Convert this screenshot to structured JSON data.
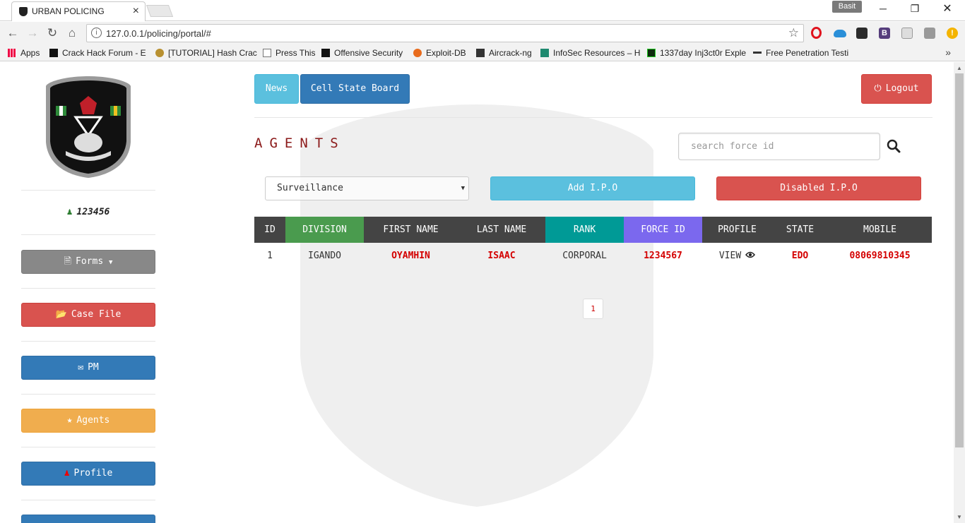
{
  "browser": {
    "tab_title": "URBAN POLICING",
    "profile_name": "Basit",
    "url": "127.0.0.1/policing/portal/#",
    "bookmarks": [
      {
        "label": "Apps"
      },
      {
        "label": "Crack Hack Forum - E"
      },
      {
        "label": "[TUTORIAL] Hash Crac"
      },
      {
        "label": "Press This"
      },
      {
        "label": "Offensive Security"
      },
      {
        "label": "Exploit-DB"
      },
      {
        "label": "Aircrack-ng"
      },
      {
        "label": "InfoSec Resources – H"
      },
      {
        "label": "1337day Inj3ct0r Exple"
      },
      {
        "label": "Free Penetration Testi"
      }
    ]
  },
  "sidebar": {
    "user_id": "123456",
    "buttons": {
      "forms": "Forms",
      "case_file": "Case File",
      "pm": "PM",
      "agents": "Agents",
      "profile": "Profile"
    }
  },
  "topnav": {
    "news": "News",
    "cell_state_board": "Cell State Board",
    "logout": "Logout"
  },
  "main": {
    "title": "AGENTS",
    "search_placeholder": "search force id",
    "select_value": "Surveillance",
    "add_ipo": "Add I.P.O",
    "disabled_ipo": "Disabled I.P.O",
    "columns": [
      "ID",
      "DIVISION",
      "FIRST NAME",
      "LAST NAME",
      "RANK",
      "FORCE ID",
      "PROFILE",
      "STATE",
      "MOBILE"
    ],
    "rows": [
      {
        "id": "1",
        "division": "IGANDO",
        "first_name": "OYAMHIN",
        "last_name": "ISAAC",
        "rank": "CORPORAL",
        "force_id": "1234567",
        "profile": "VIEW",
        "state": "EDO",
        "mobile": "08069810345"
      }
    ],
    "page": "1"
  },
  "colors": {
    "primary": "#337ab7",
    "info": "#5bc0de",
    "danger": "#d9534f",
    "warning": "#f0ad4e",
    "default_gray": "#888888",
    "header_dark": "#444444",
    "division_header": "#4a9b4e",
    "rank_header": "#009a96",
    "force_id_header": "#7b68ee"
  }
}
